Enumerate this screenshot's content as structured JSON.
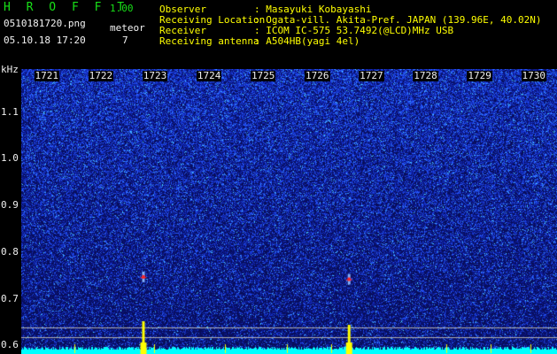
{
  "app": {
    "name": "H R O F F T",
    "version": "1.00"
  },
  "file": {
    "name": "0510181720.png",
    "datetime": "05.10.18 17:20"
  },
  "meteor": {
    "label": "meteor",
    "count": "7"
  },
  "station": {
    "observer_label": "Observer",
    "observer": ": Masayuki Kobayashi",
    "location_label": "Receiving Location",
    "location": ": Ogata-vill. Akita-Pref. JAPAN (139.96E, 40.02N)",
    "receiver_label": "Receiver",
    "receiver": ": ICOM IC-575 53.7492(@LCD)MHz USB",
    "antenna_label": "Receiving antenna",
    "antenna": ": A504HB(yagi 4el)"
  },
  "chart_data": {
    "type": "heatmap",
    "ylabel": "kHz",
    "y_ticks": [
      "1.1",
      "1.0",
      "0.9",
      "0.8",
      "0.7",
      "0.6"
    ],
    "y_tick_values": [
      1.1,
      1.0,
      0.9,
      0.8,
      0.7,
      0.6
    ],
    "ylim": [
      0.58,
      1.19
    ],
    "x_ticks": [
      "1721",
      "1722",
      "1723",
      "1724",
      "1725",
      "1726",
      "1727",
      "1728",
      "1729",
      "1730"
    ],
    "x_tick_values": [
      1721,
      1722,
      1723,
      1724,
      1725,
      1726,
      1727,
      1728,
      1729,
      1730
    ],
    "xlim": [
      1720.55,
      1730.45
    ],
    "meteor_echoes": [
      {
        "time": 1722.8,
        "freq_khz": 0.745
      },
      {
        "time": 1726.6,
        "freq_khz": 0.74
      }
    ],
    "colors": {
      "background": "#0a1070",
      "noise": "#2060ff",
      "signal": "#ff2020",
      "trace": "#00ffff",
      "burst": "#ffff00"
    }
  }
}
